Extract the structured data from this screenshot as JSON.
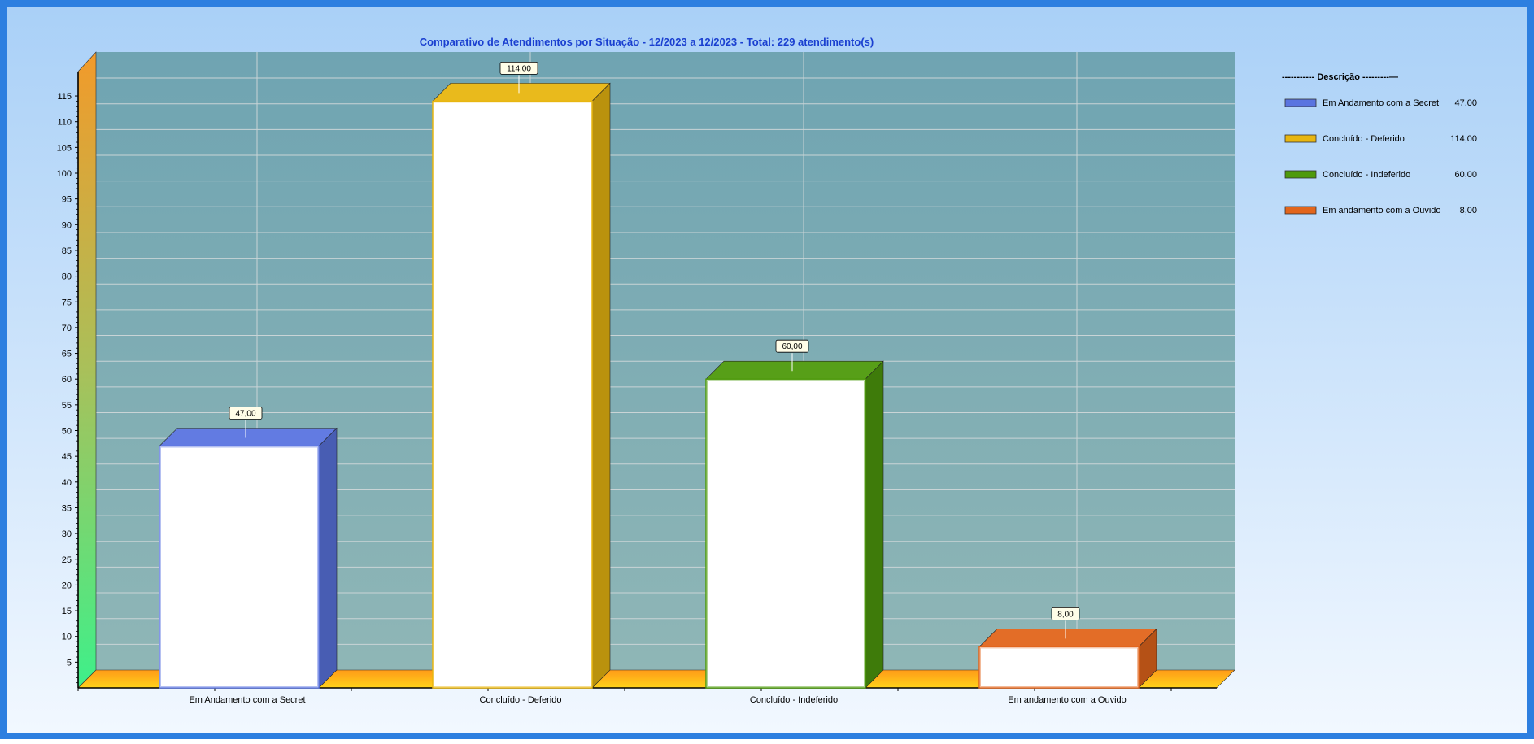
{
  "chart_data": {
    "type": "bar",
    "title": "Comparativo  de  Atendimentos  por  Situação  -  12/2023  a  12/2023  -  Total:  229  atendimento(s)",
    "categories": [
      "Em Andamento com a Secret",
      "Concluído - Deferido",
      "Concluído - Indeferido",
      "Em andamento com a Ouvido"
    ],
    "values": [
      47,
      114,
      60,
      8
    ],
    "value_labels": [
      "47,00",
      "114,00",
      "60,00",
      "8,00"
    ],
    "colors": [
      "#5a74e0",
      "#e8b610",
      "#4e9a0c",
      "#e2651c"
    ],
    "y_ticks": [
      5,
      10,
      15,
      20,
      25,
      30,
      35,
      40,
      45,
      50,
      55,
      60,
      65,
      70,
      75,
      80,
      85,
      90,
      95,
      100,
      105,
      110,
      115
    ],
    "ylim": [
      0,
      120
    ],
    "xlabel": "",
    "ylabel": "",
    "grid": true,
    "legend_position": "right",
    "legend": {
      "title": "----------- Descrição ---------—",
      "entries": [
        {
          "label": "Em Andamento com a Secret",
          "value": "47,00"
        },
        {
          "label": "Concluído - Deferido",
          "value": "114,00"
        },
        {
          "label": "Concluído - Indeferido",
          "value": "60,00"
        },
        {
          "label": "Em andamento com a Ouvido",
          "value": "8,00"
        }
      ]
    }
  }
}
